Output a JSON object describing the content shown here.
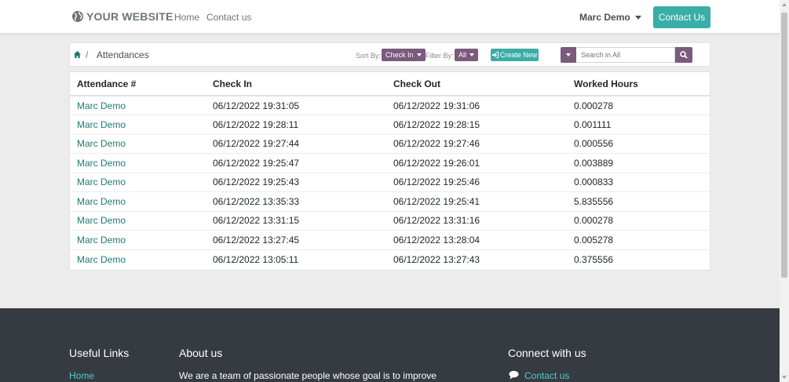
{
  "header": {
    "logo_text": "YOUR WEBSITE",
    "nav": [
      "Home",
      "Contact us"
    ],
    "user": "Marc Demo",
    "cta": "Contact Us"
  },
  "toolbar": {
    "breadcrumb_sep": "/",
    "title": "Attendances",
    "sort_label": "Sort By:",
    "sort_value": "Check In",
    "filter_label": "Filter By:",
    "filter_value": "All",
    "create_label": "Create New",
    "search_placeholder": "Search in All"
  },
  "table": {
    "columns": [
      "Attendance #",
      "Check In",
      "Check Out",
      "Worked Hours"
    ],
    "rows": [
      [
        "Marc Demo",
        "06/12/2022 19:31:05",
        "06/12/2022 19:31:06",
        "0.000278"
      ],
      [
        "Marc Demo",
        "06/12/2022 19:28:11",
        "06/12/2022 19:28:15",
        "0.001111"
      ],
      [
        "Marc Demo",
        "06/12/2022 19:27:44",
        "06/12/2022 19:27:46",
        "0.000556"
      ],
      [
        "Marc Demo",
        "06/12/2022 19:25:47",
        "06/12/2022 19:26:01",
        "0.003889"
      ],
      [
        "Marc Demo",
        "06/12/2022 19:25:43",
        "06/12/2022 19:25:46",
        "0.000833"
      ],
      [
        "Marc Demo",
        "06/12/2022 13:35:33",
        "06/12/2022 19:25:41",
        "5.835556"
      ],
      [
        "Marc Demo",
        "06/12/2022 13:31:15",
        "06/12/2022 13:31:16",
        "0.000278"
      ],
      [
        "Marc Demo",
        "06/12/2022 13:27:45",
        "06/12/2022 13:28:04",
        "0.005278"
      ],
      [
        "Marc Demo",
        "06/12/2022 13:05:11",
        "06/12/2022 13:27:43",
        "0.375556"
      ]
    ]
  },
  "footer": {
    "useful_links": "Useful Links",
    "useful_home": "Home",
    "about_title": "About us",
    "about_text": "We are a team of passionate people whose goal is to improve",
    "connect_title": "Connect with us",
    "connect_contact": "Contact us"
  },
  "colors": {
    "accent": "#3aada8",
    "purple": "#7b5a7d",
    "link": "#1e7a74",
    "footer_bg": "#363b42"
  }
}
